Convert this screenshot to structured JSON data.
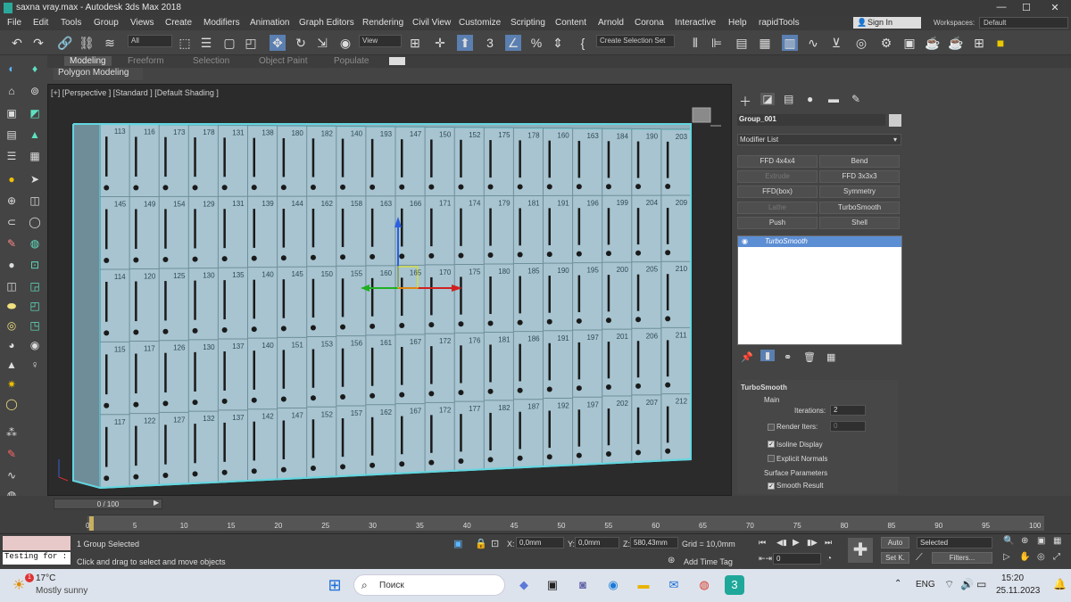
{
  "window": {
    "title": "saxna vray.max - Autodesk 3ds Max 2018",
    "minimize": "—",
    "maximize": "☐",
    "close": "✕"
  },
  "menu": [
    "File",
    "Edit",
    "Tools",
    "Group",
    "Views",
    "Create",
    "Modifiers",
    "Animation",
    "Graph Editors",
    "Rendering",
    "Civil View",
    "Customize",
    "Scripting",
    "Content",
    "Arnold",
    "Corona",
    "Interactive",
    "Help",
    "rapidTools"
  ],
  "account": {
    "sign_in": "Sign In",
    "workspaces_label": "Workspaces:",
    "workspace": "Default"
  },
  "toolbar": {
    "filter": "All",
    "view": "View",
    "selection_set": "Create Selection Set"
  },
  "ribbon": {
    "tabs": [
      "Modeling",
      "Freeform",
      "Selection",
      "Object Paint",
      "Populate"
    ],
    "active": "Modeling",
    "sub": "Polygon Modeling"
  },
  "viewport": {
    "label": "[+] [Perspective ] [Standard ] [Default Shading ]"
  },
  "lockers": {
    "columns": 20,
    "numbers_top": [
      "113",
      "116",
      "173",
      "178",
      "131",
      "138",
      "180",
      "182",
      "140",
      "193",
      "147",
      "150",
      "152",
      "175",
      "178",
      "160",
      "163",
      "184",
      "190",
      "203"
    ],
    "numbers_row2": [
      "145",
      "149",
      "154",
      "129",
      "131",
      "139",
      "144",
      "162",
      "158",
      "163",
      "166",
      "171",
      "174",
      "179",
      "181",
      "191",
      "196",
      "199",
      "204",
      "209"
    ],
    "numbers_row3": [
      "114",
      "120",
      "125",
      "130",
      "135",
      "140",
      "145",
      "150",
      "155",
      "160",
      "165",
      "170",
      "175",
      "180",
      "185",
      "190",
      "195",
      "200",
      "205",
      "210"
    ],
    "numbers_row4": [
      "115",
      "117",
      "126",
      "130",
      "137",
      "140",
      "151",
      "153",
      "156",
      "161",
      "167",
      "172",
      "176",
      "181",
      "186",
      "191",
      "197",
      "201",
      "206",
      "211"
    ],
    "numbers_row5": [
      "117",
      "122",
      "127",
      "132",
      "137",
      "142",
      "147",
      "152",
      "157",
      "162",
      "167",
      "172",
      "177",
      "182",
      "187",
      "192",
      "197",
      "202",
      "207",
      "212"
    ]
  },
  "command_panel": {
    "object_name": "Group_001",
    "modifier_list": "Modifier List",
    "buttons": [
      {
        "label": "FFD 4x4x4",
        "enabled": true
      },
      {
        "label": "Bend",
        "enabled": true
      },
      {
        "label": "Extrude",
        "enabled": false
      },
      {
        "label": "FFD 3x3x3",
        "enabled": true
      },
      {
        "label": "FFD(box)",
        "enabled": true
      },
      {
        "label": "Symmetry",
        "enabled": true
      },
      {
        "label": "Lathe",
        "enabled": false
      },
      {
        "label": "TurboSmooth",
        "enabled": true
      },
      {
        "label": "Push",
        "enabled": true
      },
      {
        "label": "Shell",
        "enabled": true
      }
    ],
    "stack_selected": "TurboSmooth",
    "rollout": {
      "title": "TurboSmooth",
      "main": "Main",
      "iterations_label": "Iterations:",
      "iterations": "2",
      "render_iters_label": "Render Iters:",
      "render_iters": "0",
      "isoline": "Isoline Display",
      "explicit_normals": "Explicit Normals",
      "surface_params": "Surface Parameters",
      "smooth_result": "Smooth Result"
    }
  },
  "timeline": {
    "slider": "0 / 100",
    "ticks": [
      "0",
      "5",
      "10",
      "15",
      "20",
      "25",
      "30",
      "35",
      "40",
      "45",
      "50",
      "55",
      "60",
      "65",
      "70",
      "75",
      "80",
      "85",
      "90",
      "95",
      "100"
    ]
  },
  "status": {
    "listener": "Testing for :",
    "selected": "1 Group Selected",
    "prompt": "Click and drag to select and move objects",
    "x_label": "X:",
    "x": "0,0mm",
    "y_label": "Y:",
    "y": "0,0mm",
    "z_label": "Z:",
    "z": "580,43mm",
    "grid": "Grid = 10,0mm",
    "add_time_tag": "Add Time Tag",
    "auto": "Auto",
    "set_key": "Set K.",
    "key_mode": "Selected",
    "filters": "Filters...",
    "frame": "0"
  },
  "taskbar": {
    "weather_temp": "17°C",
    "weather_text": "Mostly sunny",
    "search": "Поиск",
    "lang": "ENG",
    "time": "15:20",
    "date": "25.11.2023"
  },
  "colors": {
    "locker": "#a7c4d0",
    "selection": "#63d6e0",
    "stack_highlight": "#5c8ed4"
  }
}
